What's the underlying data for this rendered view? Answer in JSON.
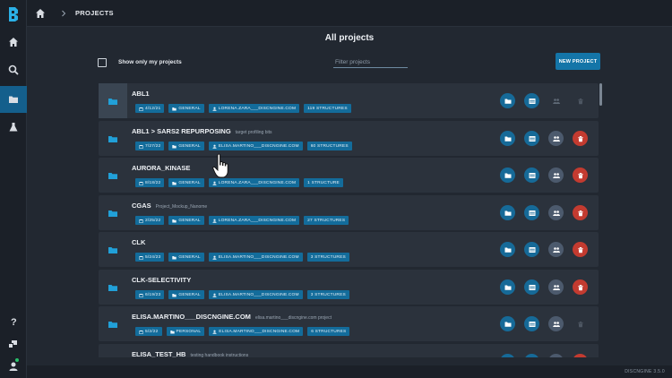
{
  "breadcrumb": {
    "current": "PROJECTS"
  },
  "page": {
    "title": "All projects",
    "show_only_mine_label": "Show only my projects",
    "filter_placeholder": "Filter projects",
    "new_project_label": "NEW PROJECT"
  },
  "projects": [
    {
      "name": "ABL1",
      "description": "",
      "date": "4/12/21",
      "visibility": "GENERAL",
      "owner": "LORENA.ZARA___DISCNGINE.COM",
      "structures": "119 STRUCTURES",
      "can_share": false,
      "can_delete": false
    },
    {
      "name": "ABL1 > SARS2 REPURPOSING",
      "description": "target profiling bits",
      "date": "7/27/22",
      "visibility": "GENERAL",
      "owner": "ELISA.MARTINO___DISCNGINE.COM",
      "structures": "60 STRUCTURES",
      "can_share": true,
      "can_delete": true
    },
    {
      "name": "AURORA_KINASE",
      "description": "",
      "date": "8/18/22",
      "visibility": "GENERAL",
      "owner": "LORENA.ZARA___DISCNGINE.COM",
      "structures": "1 STRUCTURE",
      "can_share": true,
      "can_delete": true
    },
    {
      "name": "CGAS",
      "description": "Project_Mockup_Nanome",
      "date": "2/25/22",
      "visibility": "GENERAL",
      "owner": "LORENA.ZARA___DISCNGINE.COM",
      "structures": "27 STRUCTURES",
      "can_share": true,
      "can_delete": true
    },
    {
      "name": "CLK",
      "description": "",
      "date": "5/24/23",
      "visibility": "GENERAL",
      "owner": "ELISA.MARTINO___DISCNGINE.COM",
      "structures": "3 STRUCTURES",
      "can_share": true,
      "can_delete": true
    },
    {
      "name": "CLK-SELECTIVITY",
      "description": "",
      "date": "6/19/23",
      "visibility": "GENERAL",
      "owner": "ELISA.MARTINO___DISCNGINE.COM",
      "structures": "3 STRUCTURES",
      "can_share": true,
      "can_delete": true
    },
    {
      "name": "ELISA.MARTINO___DISCNGINE.COM",
      "description": "elisa.martino___discngine.com project",
      "date": "5/2/22",
      "visibility": "PERSONAL",
      "owner": "ELISA.MARTINO___DISCNGINE.COM",
      "structures": "6 STRUCTURES",
      "can_share": true,
      "can_delete": false
    },
    {
      "name": "ELISA_TEST_HB",
      "description": "testing handbook instructions",
      "date": "",
      "visibility": "",
      "owner": "",
      "structures": "",
      "can_share": true,
      "can_delete": true
    }
  ],
  "footer": {
    "version": "DISCNGINE 3.5.0"
  },
  "colors": {
    "accent": "#1475a8",
    "danger": "#c33b30",
    "background": "#222831",
    "row": "#2b323c"
  }
}
